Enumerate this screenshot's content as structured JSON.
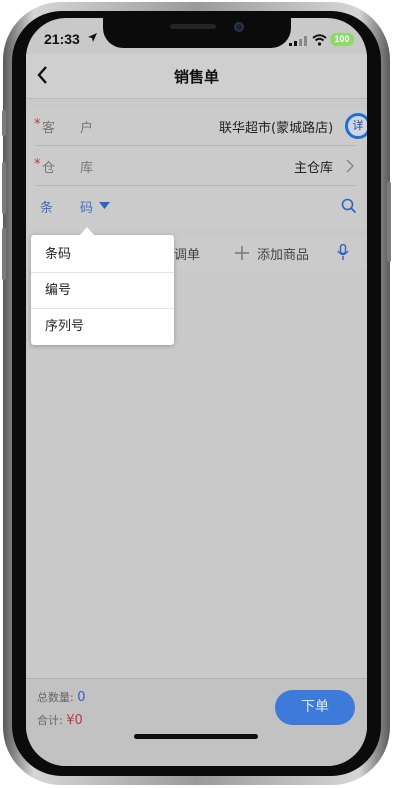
{
  "status": {
    "time": "21:33",
    "battery": "100"
  },
  "nav": {
    "title": "销售单"
  },
  "form": {
    "customer_star": "*",
    "customer_label_1": "客",
    "customer_label_2": "户",
    "customer_value": "联华超市(蒙城路店)",
    "detail_label": "详",
    "warehouse_star": "*",
    "warehouse_label_1": "仓",
    "warehouse_label_2": "库",
    "warehouse_value": "主仓库",
    "search_label_1": "条",
    "search_label_2": "码"
  },
  "toolbar": {
    "adjust_label": "调单",
    "add_label": "添加商品"
  },
  "dropdown": {
    "options": [
      "条码",
      "编号",
      "序列号"
    ]
  },
  "footer": {
    "total_qty_label": "总数量:",
    "total_qty_value": "0",
    "sum_label": "合计:",
    "sum_value": "¥0",
    "order_button": "下单"
  }
}
